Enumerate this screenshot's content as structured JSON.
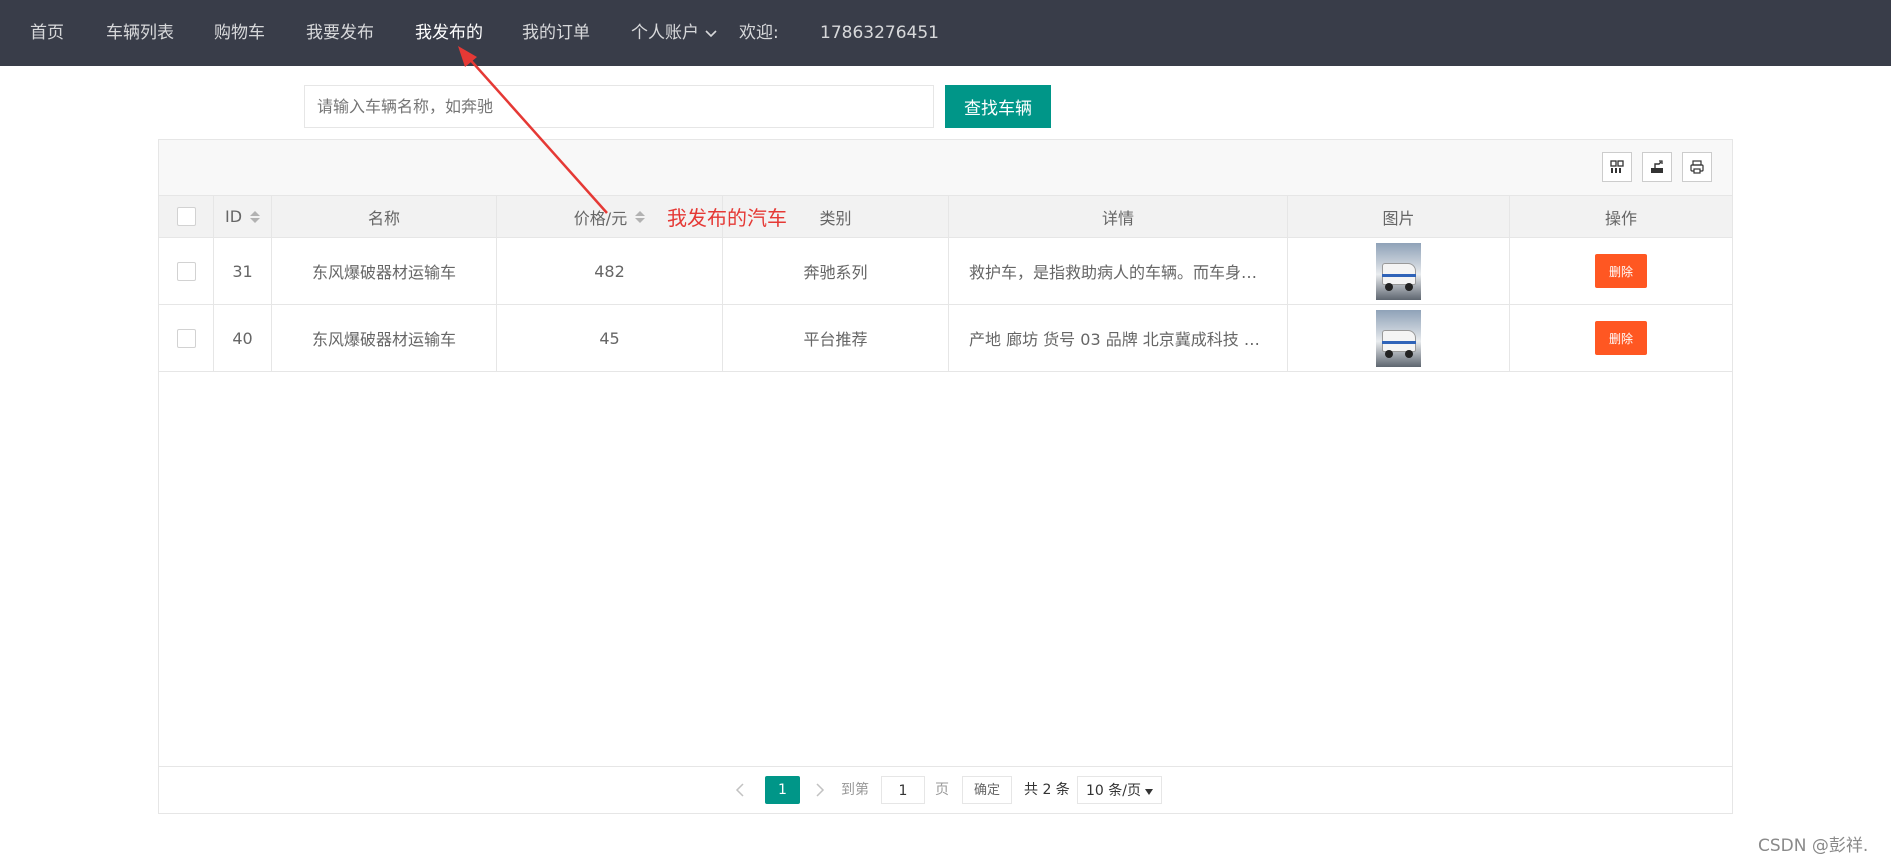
{
  "nav": {
    "items": [
      {
        "label": "首页"
      },
      {
        "label": "车辆列表"
      },
      {
        "label": "购物车"
      },
      {
        "label": "我要发布"
      },
      {
        "label": "我发布的"
      },
      {
        "label": "我的订单"
      },
      {
        "label": "个人账户"
      }
    ],
    "welcome_label": "欢迎:",
    "username": "17863276451"
  },
  "search": {
    "placeholder": "请输入车辆名称，如奔驰",
    "button_label": "查找车辆"
  },
  "toolbar": {
    "icons": [
      "columns-filter-icon",
      "export-icon",
      "print-icon"
    ]
  },
  "table": {
    "headers": {
      "id": "ID",
      "name": "名称",
      "price": "价格/元",
      "category": "类别",
      "detail": "详情",
      "image": "图片",
      "action": "操作"
    },
    "rows": [
      {
        "id": "31",
        "name": "东风爆破器材运输车",
        "price": "482",
        "category": "奔驰系列",
        "detail": "救护车，是指救助病人的车辆。而车身上...",
        "action": "删除"
      },
      {
        "id": "40",
        "name": "东风爆破器材运输车",
        "price": "45",
        "category": "平台推荐",
        "detail": "产地 廊坊 货号 03 品牌 北京冀成科技 外...",
        "action": "删除"
      }
    ]
  },
  "pagination": {
    "current_page": "1",
    "goto_label": "到第",
    "goto_value": "1",
    "page_unit": "页",
    "confirm_label": "确定",
    "total_text": "共 2 条",
    "page_size": "10 条/页"
  },
  "annotation": {
    "text": "我发布的汽车",
    "color": "#e53935"
  },
  "watermark": "CSDN @彭祥.",
  "colors": {
    "nav_bg": "#393d49",
    "primary": "#009688",
    "danger": "#ff5722"
  }
}
